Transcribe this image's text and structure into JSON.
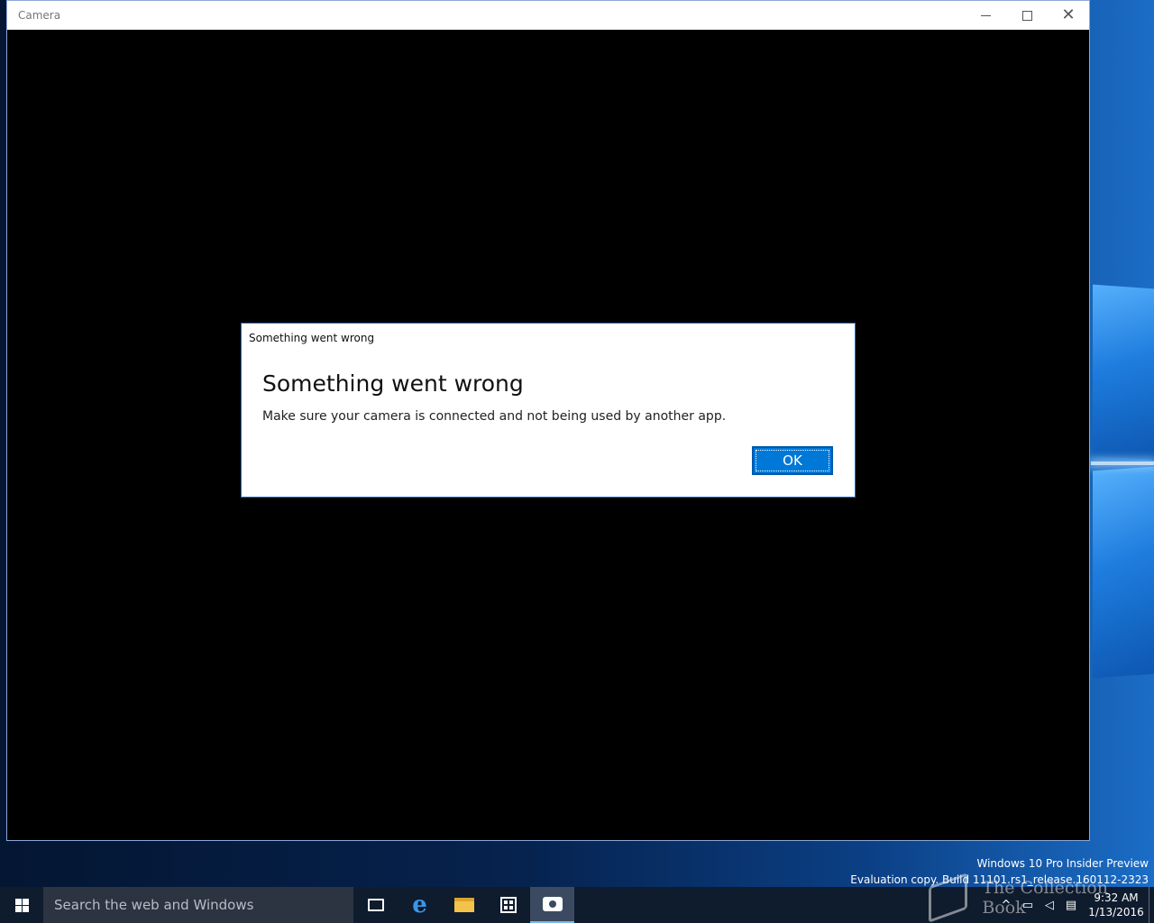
{
  "window": {
    "title": "Camera"
  },
  "dialog": {
    "caption": "Something went wrong",
    "heading": "Something went wrong",
    "message": "Make sure your camera is connected and not being used by another app.",
    "ok_label": "OK"
  },
  "watermark": {
    "line1": "Windows 10 Pro Insider Preview",
    "line2": "Evaluation copy. Build 11101.rs1_release.160112-2323"
  },
  "collection_watermark": "The Collection Book",
  "taskbar": {
    "search_placeholder": "Search the web and Windows",
    "icons": [
      "task-view-icon",
      "edge-icon",
      "file-explorer-icon",
      "store-icon",
      "camera-icon"
    ],
    "tray_icons": [
      "chevron-up-icon",
      "network-icon",
      "volume-icon",
      "action-center-icon"
    ],
    "time": "9:32 AM",
    "date": "1/13/2016"
  },
  "colors": {
    "accent": "#0078d7",
    "taskbar": "#0f1c2e",
    "window_background": "#000000"
  }
}
